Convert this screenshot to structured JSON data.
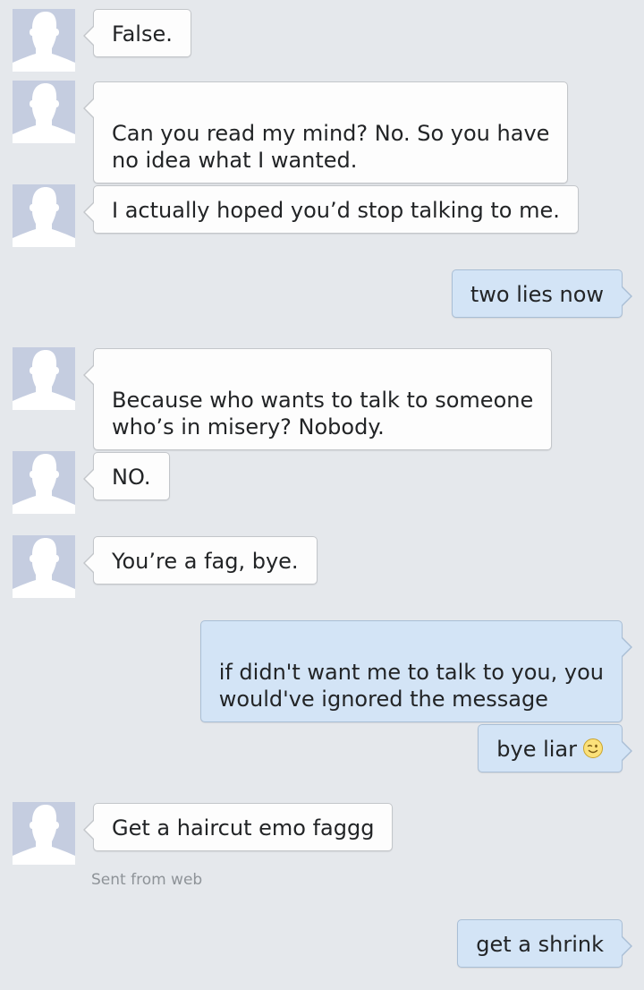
{
  "messages": [
    {
      "direction": "incoming",
      "text": "False.",
      "avatar_icon": "default-profile-silhouette-icon"
    },
    {
      "direction": "incoming",
      "text": "Can you read my mind? No. So you have\nno idea what I wanted.",
      "avatar_icon": "default-profile-silhouette-icon"
    },
    {
      "direction": "incoming",
      "text": "I actually hoped you’d stop talking to me.",
      "avatar_icon": "default-profile-silhouette-icon"
    },
    {
      "direction": "outgoing",
      "text": "two lies now"
    },
    {
      "direction": "incoming",
      "text": "Because who wants to talk to someone\nwho’s in misery? Nobody.",
      "avatar_icon": "default-profile-silhouette-icon"
    },
    {
      "direction": "incoming",
      "text": "NO.",
      "avatar_icon": "default-profile-silhouette-icon"
    },
    {
      "direction": "incoming",
      "text": "You’re a fag, bye.",
      "avatar_icon": "default-profile-silhouette-icon"
    },
    {
      "direction": "outgoing",
      "text": "if didn't want me to talk to you, you\nwould've ignored the message"
    },
    {
      "direction": "outgoing",
      "text": "bye liar",
      "emoji": "winking-face-emoji-icon"
    },
    {
      "direction": "incoming",
      "text": "Get a haircut emo faggg",
      "avatar_icon": "default-profile-silhouette-icon",
      "meta": "Sent from web"
    },
    {
      "direction": "outgoing",
      "text": "get a shrink"
    }
  ],
  "colors": {
    "background": "#e5e8ec",
    "incoming_bubble": "#fdfdfd",
    "outgoing_bubble": "#d3e4f6",
    "avatar_bg": "#c5cde0",
    "text": "#222426",
    "meta_text": "#8e9398"
  }
}
